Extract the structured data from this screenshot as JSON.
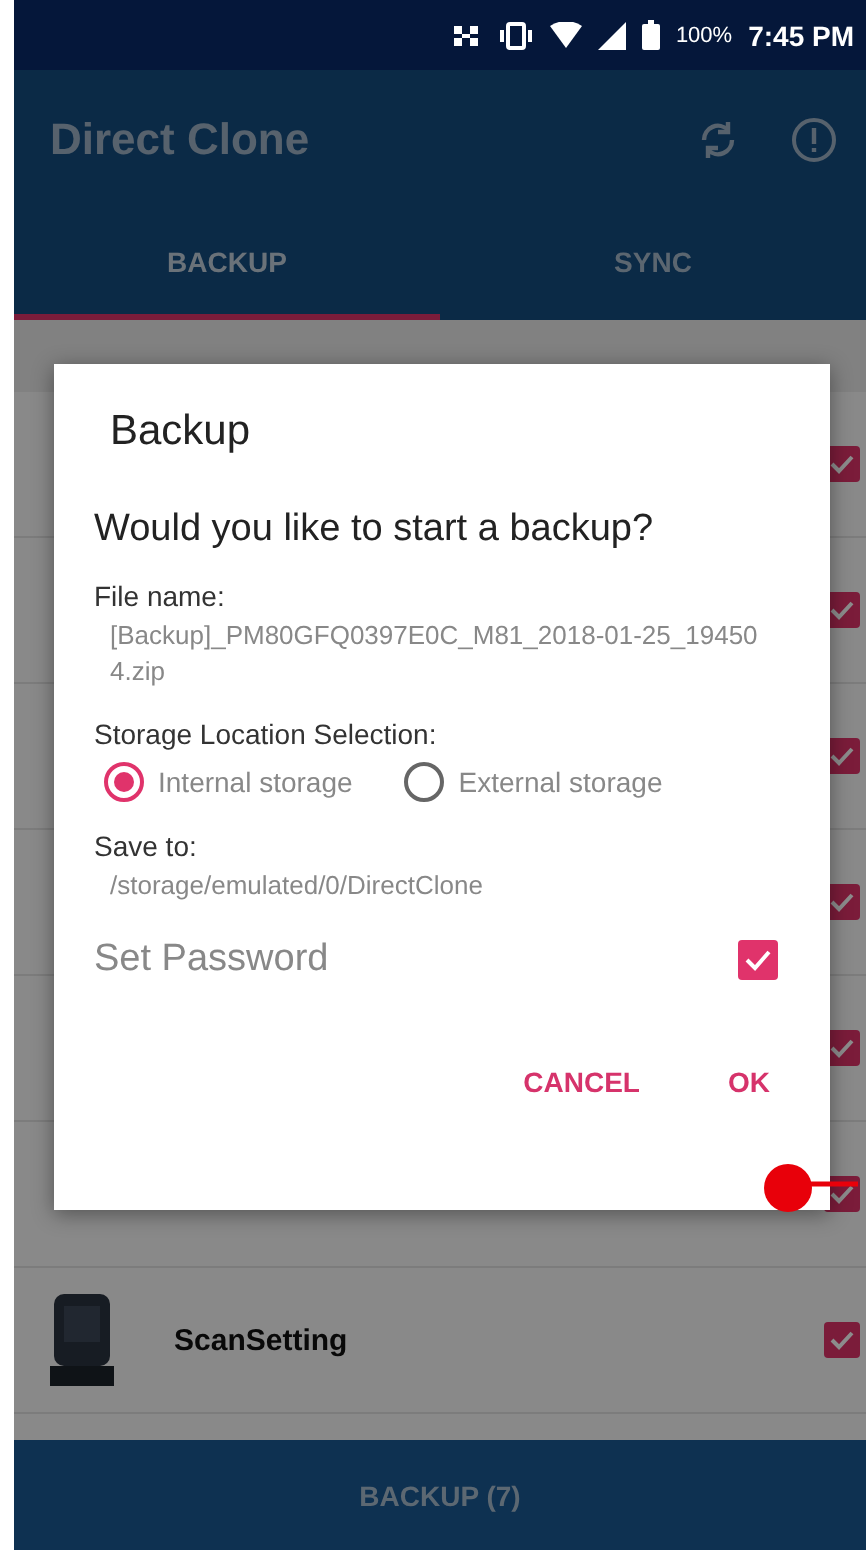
{
  "status_bar": {
    "battery": "100%",
    "time": "7:45 PM"
  },
  "app_bar": {
    "title": "Direct Clone"
  },
  "tabs": [
    {
      "label": "BACKUP",
      "selected": true
    },
    {
      "label": "SYNC",
      "selected": false
    }
  ],
  "apps": [
    {
      "checked": true
    },
    {
      "checked": true
    },
    {
      "checked": true
    },
    {
      "checked": true
    },
    {
      "checked": true
    },
    {
      "checked": true
    },
    {
      "name": "ScanSetting",
      "checked": true
    }
  ],
  "dialog": {
    "title": "Backup",
    "question": "Would you like to start a backup?",
    "file_name_label": "File name:",
    "file_name": "[Backup]_PM80GFQ0397E0C_M81_2018-01-25_194504.zip",
    "storage_label": "Storage Location Selection:",
    "storage_options": [
      {
        "label": "Internal storage",
        "selected": true
      },
      {
        "label": "External storage",
        "selected": false
      }
    ],
    "save_to_label": "Save to:",
    "save_to": "/storage/emulated/0/DirectClone",
    "password": {
      "label": "Set Password",
      "checked": true
    },
    "buttons": [
      "CANCEL",
      "OK"
    ]
  },
  "bottom_button": "BACKUP (7)"
}
